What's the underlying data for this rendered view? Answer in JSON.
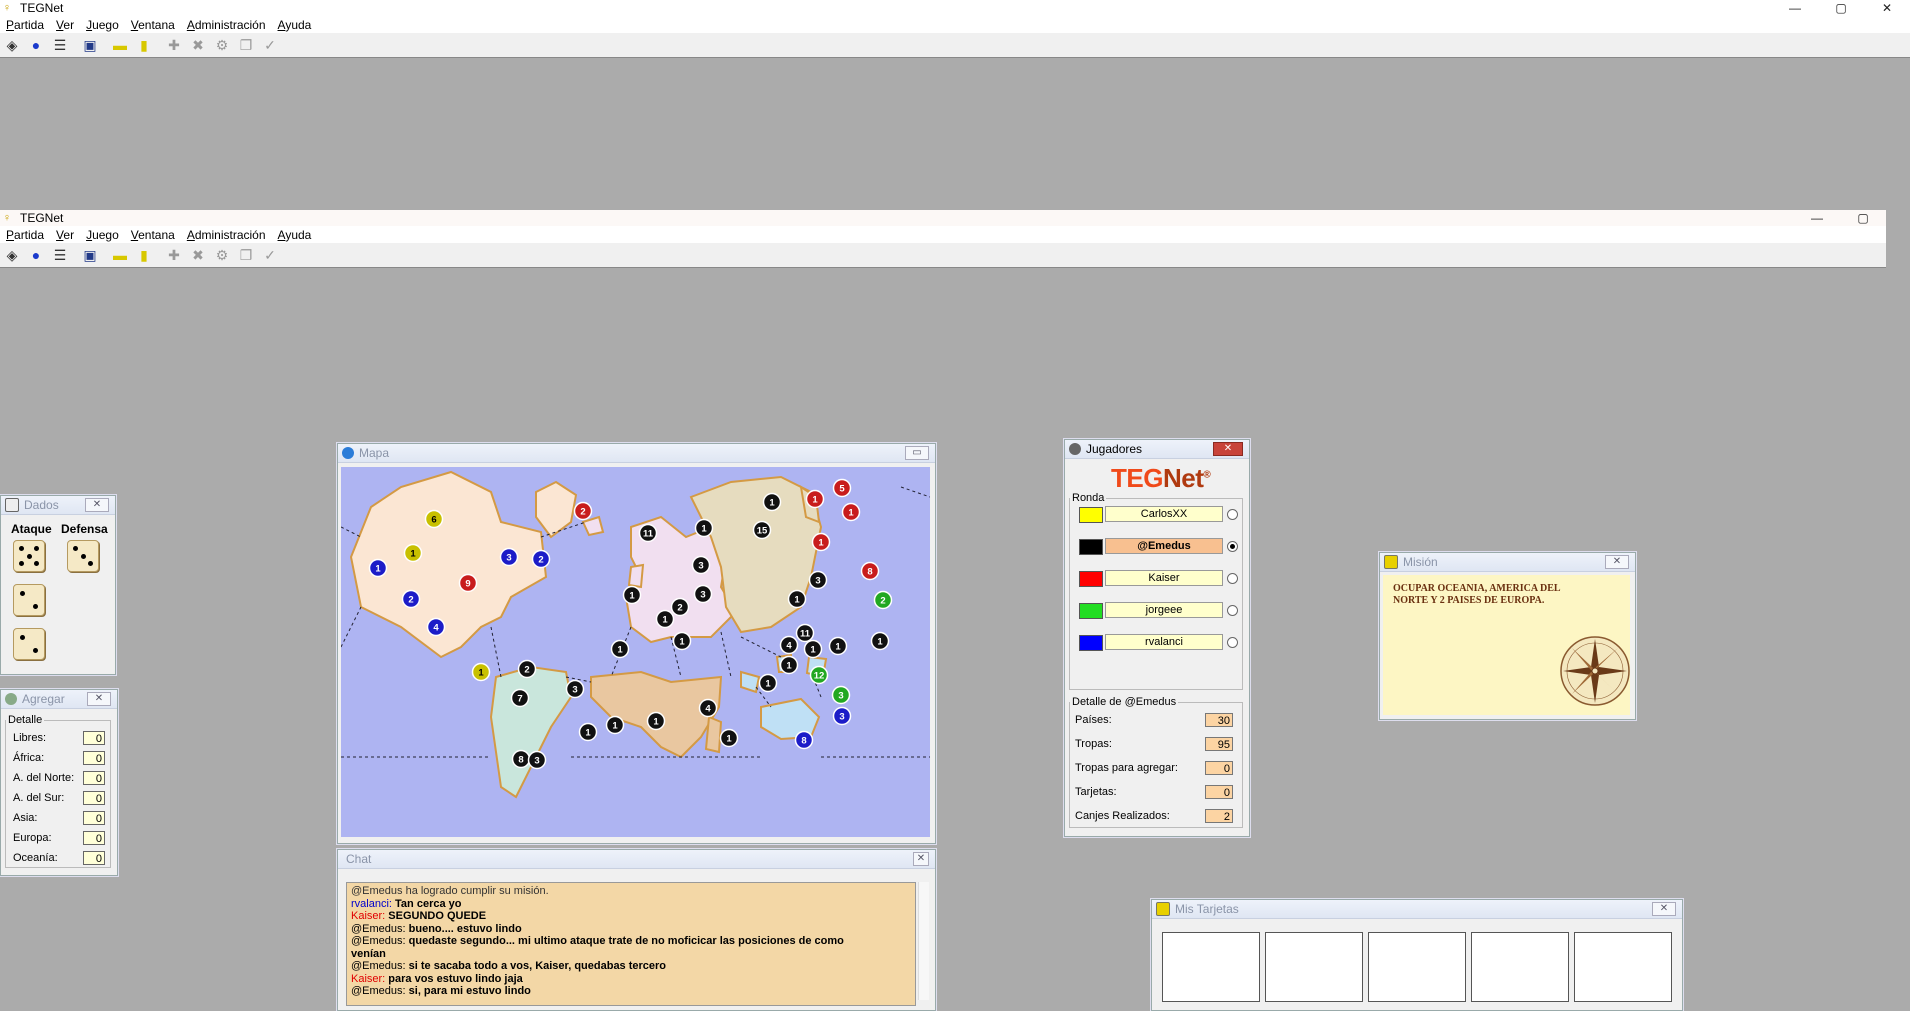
{
  "outer_window": {
    "title": "TEGNet",
    "controls": [
      "—",
      "▢",
      "✕"
    ]
  },
  "inner_window": {
    "title": "TEGNet",
    "controls": [
      "—",
      "▢"
    ]
  },
  "menu": [
    "Partida",
    "Ver",
    "Juego",
    "Ventana",
    "Administración",
    "Ayuda"
  ],
  "toolbar_icons": [
    "connect-icon",
    "globe-icon",
    "list-icon",
    "save-icon",
    "card-yellow-icon",
    "card-single-icon",
    "add-icon",
    "remove-icon",
    "gear-icon",
    "copy-icon",
    "check-icon"
  ],
  "dados": {
    "title": "Dados",
    "attack_label": "Ataque",
    "defense_label": "Defensa",
    "attack_dice": [
      5,
      2,
      2
    ],
    "defense_dice": [
      3
    ]
  },
  "agregar": {
    "title": "Agregar",
    "group": "Detalle",
    "rows": [
      {
        "label": "Libres:",
        "value": "0"
      },
      {
        "label": "África:",
        "value": "0"
      },
      {
        "label": "A. del Norte:",
        "value": "0"
      },
      {
        "label": "A. del Sur:",
        "value": "0"
      },
      {
        "label": "Asia:",
        "value": "0"
      },
      {
        "label": "Europa:",
        "value": "0"
      },
      {
        "label": "Oceanía:",
        "value": "0"
      }
    ]
  },
  "mapa": {
    "title": "Mapa",
    "colors": {
      "sea": "#aeb4f2",
      "na": "#fbe6d3",
      "sa": "#c9e6dc",
      "eu": "#f1dff0",
      "af": "#e9c7a0",
      "as": "#e6dcbf",
      "oc": "#bfe0f5"
    },
    "markers": [
      {
        "n": "6",
        "c": "#c8c000"
      },
      {
        "n": "1",
        "c": "#c8c000"
      },
      {
        "n": "1",
        "c": "#1c1cc8"
      },
      {
        "n": "2",
        "c": "#1c1cc8"
      },
      {
        "n": "3",
        "c": "#1c1cc8"
      },
      {
        "n": "9",
        "c": "#c81c1c"
      },
      {
        "n": "2",
        "c": "#1c1cc8"
      },
      {
        "n": "4",
        "c": "#1c1cc8"
      },
      {
        "n": "1",
        "c": "#c8c000"
      },
      {
        "n": "2",
        "c": "#c81c1c"
      },
      {
        "n": "11",
        "c": "#111"
      },
      {
        "n": "1",
        "c": "#111"
      },
      {
        "n": "3",
        "c": "#111"
      },
      {
        "n": "1",
        "c": "#111"
      },
      {
        "n": "1",
        "c": "#111"
      },
      {
        "n": "3",
        "c": "#111"
      },
      {
        "n": "2",
        "c": "#111"
      },
      {
        "n": "1",
        "c": "#111"
      },
      {
        "n": "1",
        "c": "#111"
      },
      {
        "n": "15",
        "c": "#111"
      },
      {
        "n": "1",
        "c": "#111"
      },
      {
        "n": "1",
        "c": "#c81c1c"
      },
      {
        "n": "5",
        "c": "#c81c1c"
      },
      {
        "n": "1",
        "c": "#c81c1c"
      },
      {
        "n": "1",
        "c": "#c81c1c"
      },
      {
        "n": "3",
        "c": "#111"
      },
      {
        "n": "8",
        "c": "#c81c1c"
      },
      {
        "n": "1",
        "c": "#111"
      },
      {
        "n": "11",
        "c": "#111"
      },
      {
        "n": "4",
        "c": "#111"
      },
      {
        "n": "1",
        "c": "#111"
      },
      {
        "n": "1",
        "c": "#111"
      },
      {
        "n": "1",
        "c": "#111"
      },
      {
        "n": "2",
        "c": "#22a822"
      },
      {
        "n": "2",
        "c": "#111"
      },
      {
        "n": "3",
        "c": "#111"
      },
      {
        "n": "7",
        "c": "#111"
      },
      {
        "n": "1",
        "c": "#111"
      },
      {
        "n": "8",
        "c": "#111"
      },
      {
        "n": "3",
        "c": "#111"
      },
      {
        "n": "1",
        "c": "#111"
      },
      {
        "n": "4",
        "c": "#111"
      },
      {
        "n": "1",
        "c": "#111"
      },
      {
        "n": "1",
        "c": "#111"
      },
      {
        "n": "1",
        "c": "#111"
      },
      {
        "n": "1",
        "c": "#111"
      },
      {
        "n": "12",
        "c": "#22a822"
      },
      {
        "n": "3",
        "c": "#22a822"
      },
      {
        "n": "3",
        "c": "#1c1cc8"
      },
      {
        "n": "8",
        "c": "#1c1cc8"
      }
    ]
  },
  "jugadores": {
    "title": "Jugadores",
    "logo_teg": "TEG",
    "logo_net": "Net",
    "logo_mark": "®",
    "group": "Ronda",
    "players": [
      {
        "name": "CarlosXX",
        "color": "#ffff00",
        "active": false,
        "bold": false,
        "highlight": false
      },
      {
        "name": "@Emedus",
        "color": "#000000",
        "active": true,
        "bold": true,
        "highlight": true
      },
      {
        "name": "Kaiser",
        "color": "#ff0000",
        "active": false,
        "bold": false,
        "highlight": false
      },
      {
        "name": "jorgeee",
        "color": "#22dd22",
        "active": false,
        "bold": false,
        "highlight": false
      },
      {
        "name": "rvalanci",
        "color": "#0000ff",
        "active": false,
        "bold": false,
        "highlight": false
      }
    ],
    "detail_group": "Detalle de @Emedus",
    "details": [
      {
        "label": "Países:",
        "value": "30"
      },
      {
        "label": "Tropas:",
        "value": "95"
      },
      {
        "label": "Tropas para agregar:",
        "value": "0"
      },
      {
        "label": "Tarjetas:",
        "value": "0"
      },
      {
        "label": "Canjes Realizados:",
        "value": "2"
      }
    ]
  },
  "mision": {
    "title": "Misión",
    "text": "OCUPAR OCEANIA, AMERICA DEL NORTE Y 2 PAISES DE EUROPA."
  },
  "chat": {
    "title": "Chat",
    "lines": [
      {
        "who": "",
        "color": "#333",
        "text": "@Emedus ha logrado cumplir su misión.",
        "bold": false
      },
      {
        "who": "rvalanci: ",
        "color": "#0000cc",
        "text": "Tan cerca yo",
        "bold": true
      },
      {
        "who": "Kaiser: ",
        "color": "#e00000",
        "text": "SEGUNDO QUEDE",
        "bold": true
      },
      {
        "who": "@Emedus: ",
        "color": "#000",
        "text": "bueno.... estuvo lindo",
        "bold": true
      },
      {
        "who": "@Emedus: ",
        "color": "#000",
        "text": "quedaste segundo... mi ultimo ataque trate de no moficicar las posiciones de como",
        "bold": true
      },
      {
        "who": "",
        "color": "#000",
        "text": "venían",
        "bold": true
      },
      {
        "who": "@Emedus: ",
        "color": "#000",
        "text": "si te sacaba todo a vos, Kaiser, quedabas tercero",
        "bold": true
      },
      {
        "who": "Kaiser: ",
        "color": "#e00000",
        "text": "para vos estuvo lindo jaja",
        "bold": true
      },
      {
        "who": "@Emedus: ",
        "color": "#000",
        "text": "si, para mi estuvo lindo",
        "bold": true
      }
    ]
  },
  "tarjetas": {
    "title": "Mis Tarjetas",
    "cards": [
      "",
      "",
      "",
      "",
      ""
    ]
  }
}
